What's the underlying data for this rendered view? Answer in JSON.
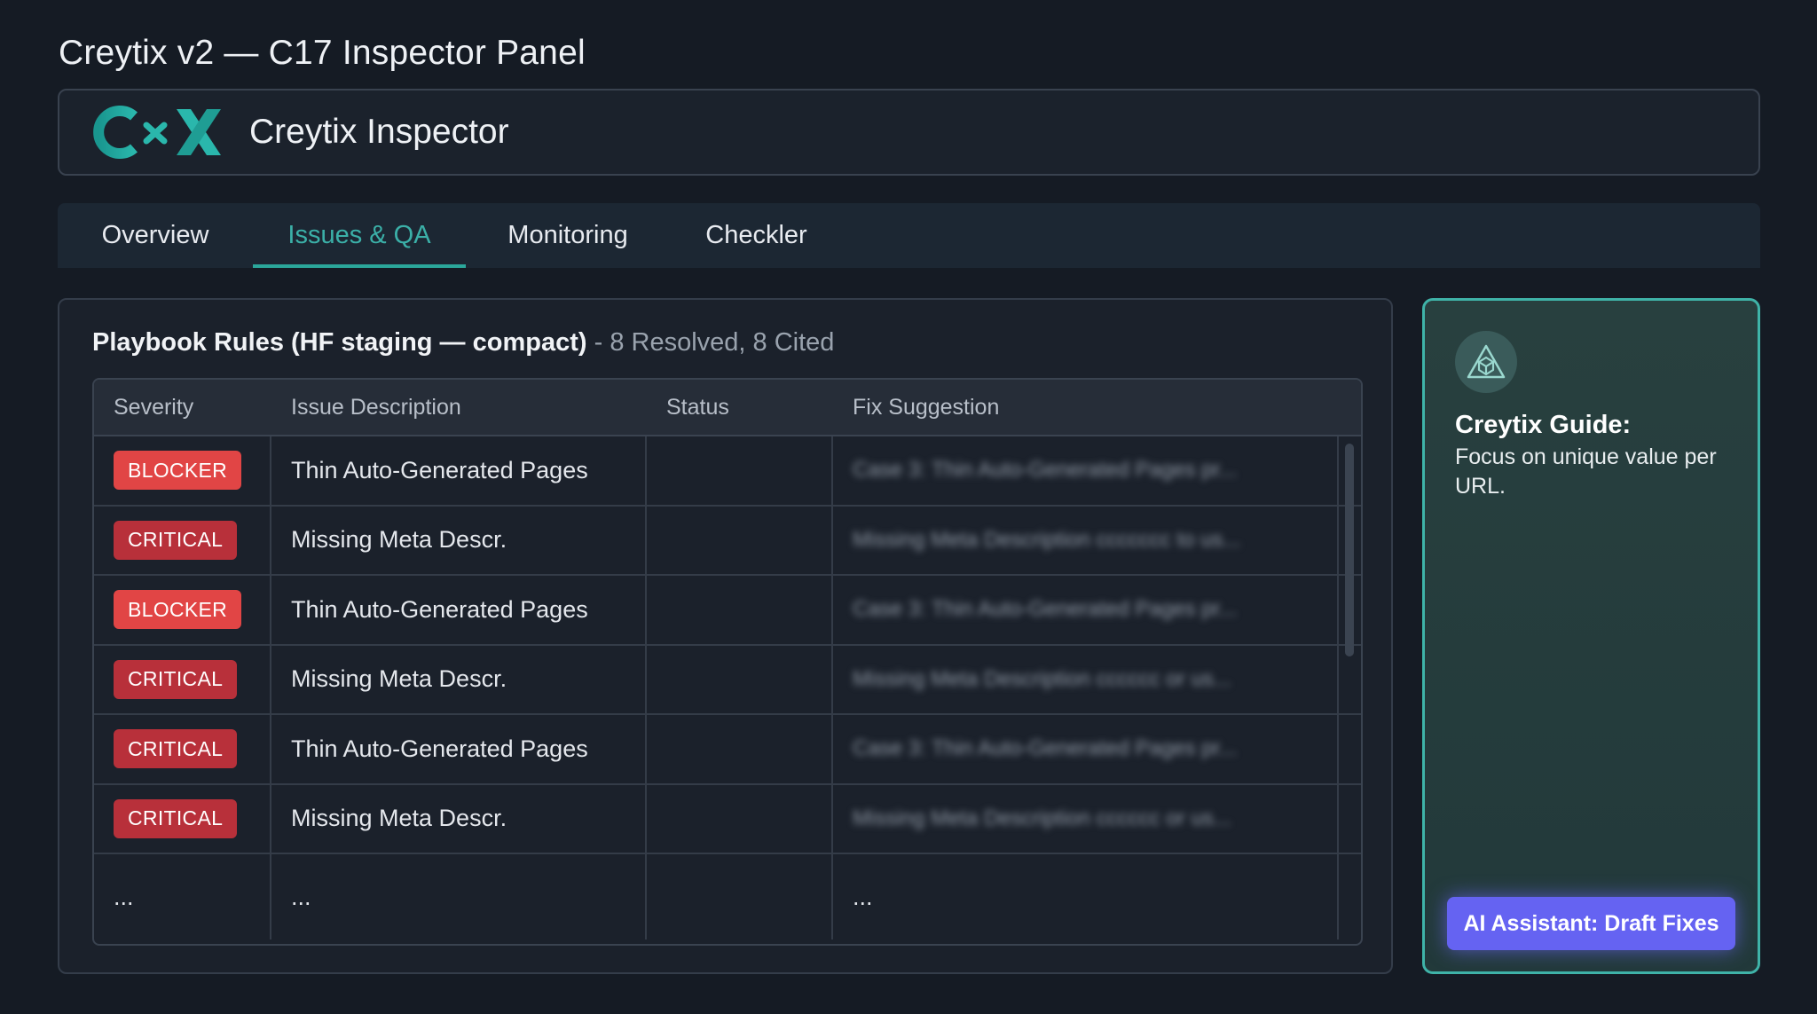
{
  "page_title": "Creytix v2 — C17 Inspector Panel",
  "header": {
    "logo_text": "CxX",
    "brand_name": "Creytix Inspector"
  },
  "tabs": [
    {
      "label": "Overview",
      "active": false
    },
    {
      "label": "Issues & QA",
      "active": true
    },
    {
      "label": "Monitoring",
      "active": false
    },
    {
      "label": "Checkler",
      "active": false
    }
  ],
  "rules": {
    "heading": "Playbook Rules (HF staging — compact)",
    "separator": "-",
    "meta": "8 Resolved, 8 Cited",
    "columns": [
      "Severity",
      "Issue Description",
      "Status",
      "Fix Suggestion"
    ],
    "rows": [
      {
        "severity": "BLOCKER",
        "level": "blocker",
        "description": "Thin Auto-Generated Pages",
        "status": "",
        "fix": "Case 3: Thin Auto-Generated Pages pr..."
      },
      {
        "severity": "CRITICAL",
        "level": "critical",
        "description": "Missing Meta Descr.",
        "status": "",
        "fix": "Missing Meta Description ccccccc to us..."
      },
      {
        "severity": "BLOCKER",
        "level": "blocker",
        "description": "Thin Auto-Generated Pages",
        "status": "",
        "fix": "Case 3: Thin Auto-Generated Pages pr..."
      },
      {
        "severity": "CRITICAL",
        "level": "critical",
        "description": "Missing Meta Descr.",
        "status": "",
        "fix": "Missing Meta Description cccccc or us..."
      },
      {
        "severity": "CRITICAL",
        "level": "critical",
        "description": "Thin Auto-Generated Pages",
        "status": "",
        "fix": "Case 3: Thin Auto-Generated Pages pr..."
      },
      {
        "severity": "CRITICAL",
        "level": "critical",
        "description": "Missing Meta Descr.",
        "status": "",
        "fix": "Missing Meta Description cccccc or us..."
      }
    ],
    "ellipsis": "..."
  },
  "guide": {
    "icon": "triangle-cube-icon",
    "title": "Creytix Guide:",
    "text": "Focus on unique value per URL.",
    "button_label": "AI Assistant: Draft Fixes"
  },
  "colors": {
    "accent": "#2ba79b",
    "blocker": "#e14545",
    "critical": "#b8303a",
    "assistant": "#6563f2"
  }
}
